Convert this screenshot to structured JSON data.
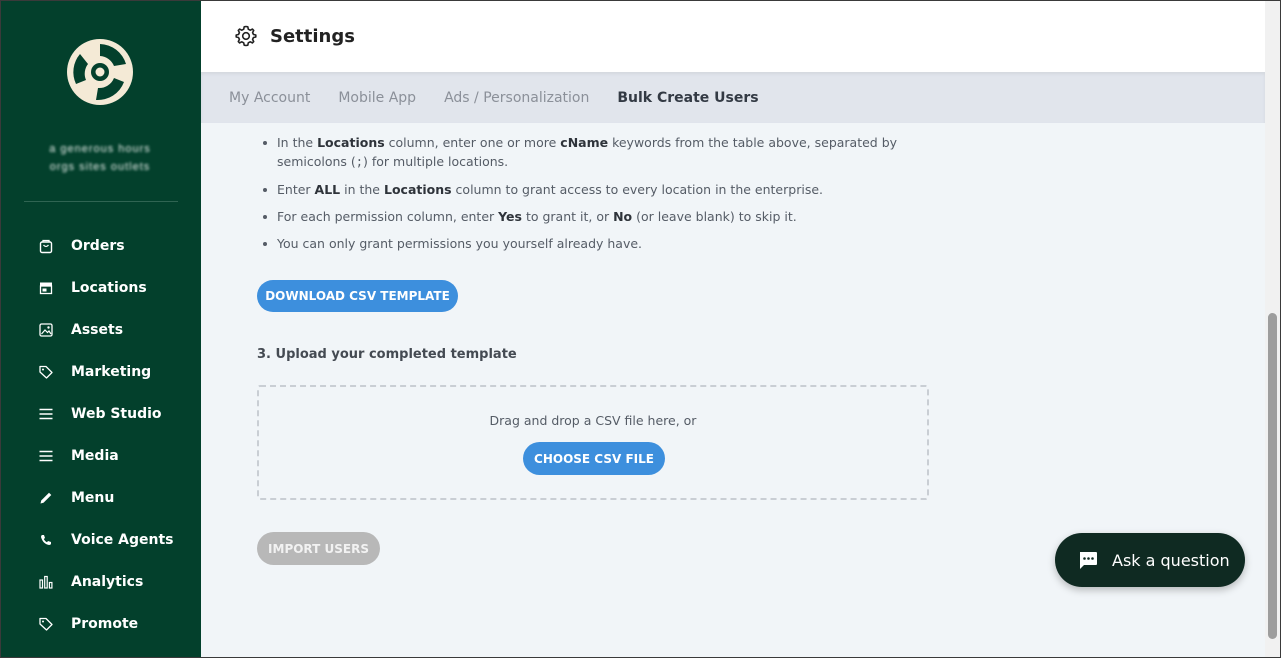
{
  "sidebar": {
    "org_name_line1": "a generous hours",
    "org_name_line2": "orgs sites outlets",
    "items": [
      {
        "label": "Orders",
        "icon": "bag-icon"
      },
      {
        "label": "Locations",
        "icon": "store-icon"
      },
      {
        "label": "Assets",
        "icon": "image-icon"
      },
      {
        "label": "Marketing",
        "icon": "tag-icon"
      },
      {
        "label": "Web Studio",
        "icon": "menu-lines-icon"
      },
      {
        "label": "Media",
        "icon": "menu-lines-icon"
      },
      {
        "label": "Menu",
        "icon": "pencil-icon"
      },
      {
        "label": "Voice Agents",
        "icon": "phone-icon"
      },
      {
        "label": "Analytics",
        "icon": "bar-chart-icon"
      },
      {
        "label": "Promote",
        "icon": "tag-icon"
      }
    ]
  },
  "header": {
    "title": "Settings"
  },
  "tabs": [
    {
      "label": "My Account",
      "active": false
    },
    {
      "label": "Mobile App",
      "active": false
    },
    {
      "label": "Ads / Personalization",
      "active": false
    },
    {
      "label": "Bulk Create Users",
      "active": true
    }
  ],
  "instructions": {
    "b1_pre": "In the ",
    "b1_bold1": "Locations",
    "b1_mid": " column, enter one or more ",
    "b1_bold2": "cName",
    "b1_post": " keywords from the table above, separated by semicolons (",
    "b1_code": ";",
    "b1_end": ") for multiple locations.",
    "b2_pre": "Enter ",
    "b2_bold1": "ALL",
    "b2_mid": " in the ",
    "b2_bold2": "Locations",
    "b2_post": " column to grant access to every location in the enterprise.",
    "b3_pre": "For each permission column, enter ",
    "b3_bold1": "Yes",
    "b3_mid": " to grant it, or ",
    "b3_bold2": "No",
    "b3_post": " (or leave blank) to skip it.",
    "b4": "You can only grant permissions you yourself already have."
  },
  "download_button": "DOWNLOAD CSV TEMPLATE",
  "upload": {
    "title": "3. Upload your completed template",
    "drop_text": "Drag and drop a CSV file here, or",
    "choose_button": "CHOOSE CSV FILE"
  },
  "import_button": "IMPORT USERS",
  "ask": {
    "label": "Ask a question"
  },
  "colors": {
    "sidebar_bg": "#03402c",
    "accent": "#3d8fdd",
    "disabled": "#b8b8b8",
    "fab_bg": "#0f2a22"
  }
}
